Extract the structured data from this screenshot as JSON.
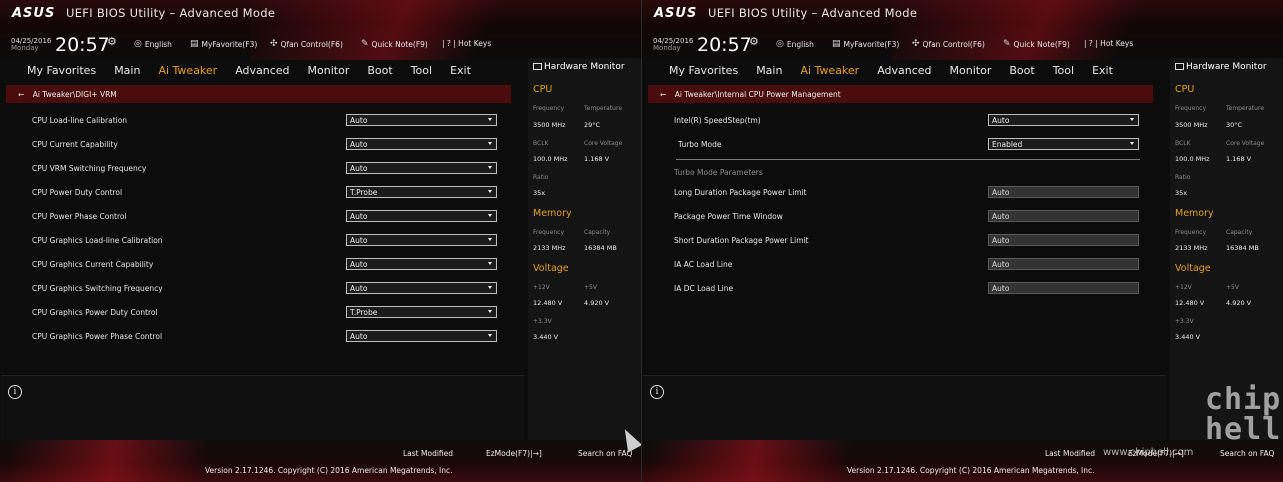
{
  "header": {
    "logo": "ASUS",
    "title": "UEFI BIOS Utility – Advanced Mode",
    "date": "04/25/2016",
    "day": "Monday",
    "time": "20:57",
    "language": "English",
    "my_favorite": "MyFavorite(F3)",
    "qfan": "Qfan Control(F6)",
    "quick_note": "Quick Note(F9)",
    "hot_keys": "| ? | Hot Keys"
  },
  "nav": [
    "My Favorites",
    "Main",
    "Ai Tweaker",
    "Advanced",
    "Monitor",
    "Boot",
    "Tool",
    "Exit"
  ],
  "nav_active": "Ai Tweaker",
  "left_panel": {
    "breadcrumb": "Ai Tweaker\\DIGI+ VRM",
    "settings": [
      {
        "label": "CPU Load-line Calibration",
        "value": "Auto"
      },
      {
        "label": "CPU Current Capability",
        "value": "Auto"
      },
      {
        "label": "CPU VRM Switching Frequency",
        "value": "Auto"
      },
      {
        "label": "CPU Power Duty Control",
        "value": "T.Probe"
      },
      {
        "label": "CPU Power Phase Control",
        "value": "Auto"
      },
      {
        "label": "CPU Graphics Load-line Calibration",
        "value": "Auto"
      },
      {
        "label": "CPU Graphics Current Capability",
        "value": "Auto"
      },
      {
        "label": "CPU Graphics Switching Frequency",
        "value": "Auto"
      },
      {
        "label": "CPU Graphics Power Duty Control",
        "value": "T.Probe"
      },
      {
        "label": "CPU Graphics Power Phase Control",
        "value": "Auto"
      }
    ]
  },
  "right_panel": {
    "breadcrumb": "Ai Tweaker\\Internal CPU Power Management",
    "speedstep": {
      "label": "Intel(R) SpeedStep(tm)",
      "value": "Auto"
    },
    "turbo": {
      "label": "Turbo Mode",
      "value": "Enabled"
    },
    "turbo_params_heading": "Turbo Mode Parameters",
    "params": [
      {
        "label": "Long Duration Package Power Limit",
        "value": "Auto"
      },
      {
        "label": "Package Power Time Window",
        "value": "Auto"
      },
      {
        "label": "Short Duration Package Power Limit",
        "value": "Auto"
      },
      {
        "label": "IA AC Load Line",
        "value": "Auto"
      },
      {
        "label": "IA DC Load Line",
        "value": "Auto"
      }
    ]
  },
  "hw_monitor": {
    "title": "Hardware Monitor",
    "cpu_heading": "CPU",
    "freq_label": "Frequency",
    "temp_label": "Temperature",
    "bclk_label": "BCLK",
    "core_voltage_label": "Core Voltage",
    "ratio_label": "Ratio",
    "memory_heading": "Memory",
    "capacity_label": "Capacity",
    "voltage_heading": "Voltage",
    "v12_label": "+12V",
    "v5_label": "+5V",
    "v33_label": "+3.3V",
    "cpu_freq": "3500 MHz",
    "bclk": "100.0 MHz",
    "core_voltage": "1.168 V",
    "ratio": "35x",
    "mem_freq": "2133 MHz",
    "mem_capacity": "16384 MB",
    "v12": "12.480 V",
    "v5": "4.920 V",
    "v33": "3.440 V",
    "temp_left": "29°C",
    "temp_right": "30°C"
  },
  "footer": {
    "last_modified": "Last Modified",
    "ezmode": "EzMode(F7)|→]",
    "search": "Search on FAQ",
    "version": "Version 2.17.1246. Copyright (C) 2016 American Megatrends, Inc."
  },
  "watermark": {
    "url": "www.chiphell.com",
    "logo": "chip hell"
  },
  "colors": {
    "accent": "#e4a020",
    "breadcrumb_bg": "#4a0c0c",
    "header_red": "#8a0f18"
  }
}
